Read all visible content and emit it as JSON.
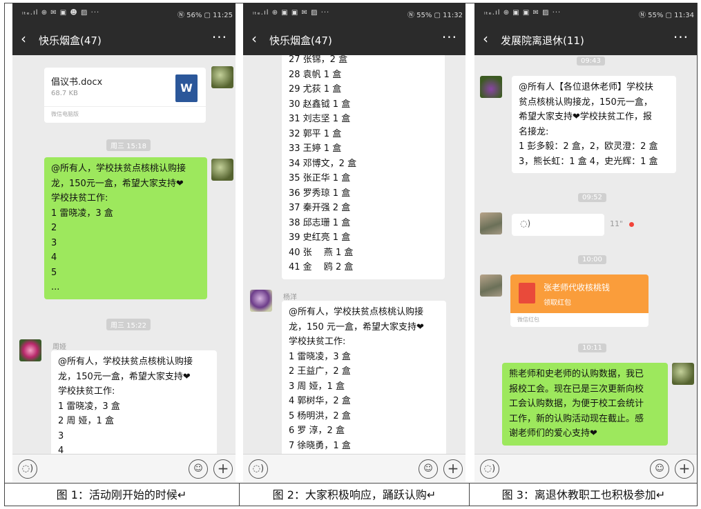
{
  "status": {
    "p1": {
      "left": "ₗₜₑ.ıl ⊕ ✉ ▣ ☻ ▨ ···",
      "right": "Ⓝ 56% ▢ 11:25"
    },
    "p2": {
      "left": "ₗₜₑ.ıl ⊕ ▣ ▣ ✉ ▨ ···",
      "right": "Ⓝ 55% ▢ 11:32"
    },
    "p3": {
      "left": "ₗₜₑ.ıl ⊕ ▣ ▣ ✉ ▨ ···",
      "right": "Ⓝ 55% ▢ 11:34"
    }
  },
  "panels": {
    "p1": {
      "title": "快乐烟盒(47)",
      "file_name": "倡议书.docx",
      "file_size": "68.7 KB",
      "file_icon": "W",
      "file_source": "微信电脑版",
      "time1": "周三 15:18",
      "msg1": "@所有人，学校扶贫点核桃认购接\n龙，150元一盒，希望大家支持❤\n学校扶贫工作:\n1 雷晓凌，3 盒\n2\n3\n4\n5\n...",
      "time2": "周三 15:22",
      "sender": "周娅",
      "msg2": "@所有人，学校扶贫点核桃认购接\n龙，150元一盒，希望大家支持❤\n学校扶贫工作:\n1 雷晓凌，3 盒\n2 周 娅，1 盒\n3\n4"
    },
    "p2": {
      "title": "快乐烟盒(47)",
      "list": "27 张锦，2 盒\n28 袁帆 1 盒\n29 尤荻 1 盒\n30 赵鑫钺 1 盒\n31 刘志坚 1 盒\n32 郭平 1 盒\n33 王婷 1 盒\n34 邓博文，2 盒\n35 张正华 1 盒\n36 罗秀琼 1 盒\n37 秦开强 2 盒\n38 邱志珊 1 盒\n39 史红亮 1 盒\n40 张　 燕 1 盒\n41 金　 鸥 2 盒",
      "sender": "杨洋",
      "msg": "@所有人，学校扶贫点核桃认购接\n龙，150 元一盒，希望大家支持❤\n学校扶贫工作:\n1 雷晓凌，3 盒\n2 王益广，2 盒\n3 周 娅，1 盒\n4 郭树华，2 盒\n5 杨明洪，2 盒\n6 罗 淳，2 盒\n7 徐晓勇，1 盒"
    },
    "p3": {
      "title": "发展院离退休(11)",
      "time0": "09:43",
      "msg1": "@所有人【各位退休老师】学校扶\n贫点核桃认购接龙，150元一盒，\n希望大家支持❤学校扶贫工作，报\n名接龙:\n1 彭多毅：2 盒，2，欧灵澄：2 盒\n3，熊长虹：1 盒 4，史光辉：1 盒",
      "time1": "09:52",
      "voice_duration": "11\"",
      "time2": "10:00",
      "redpacket_title": "张老师代收核桃钱",
      "redpacket_sub": "领取红包",
      "redpacket_footer": "微信红包",
      "time3": "10:11",
      "msg2": "熊老师和史老师的认购数据，我已\n报校工会。现在已是三次更新向校\n工会认购数据，为便于校工会统计\n工作，新的认购活动现在截止。感\n谢老师们的爱心支持❤"
    }
  },
  "captions": {
    "c1": "图 1：活动刚开始的时候↵",
    "c2": "图 2：大家积极响应，踊跃认购↵",
    "c3": "图 3：离退休教职工也积极参加↵"
  },
  "icons": {
    "back": "‹",
    "more": "···",
    "voice": "◌)",
    "emoji": "☺",
    "plus": "+"
  },
  "colors": {
    "green_bubble": "#9de85d",
    "redpacket": "#fa9d3b",
    "titlebar": "#2b2b2b"
  }
}
